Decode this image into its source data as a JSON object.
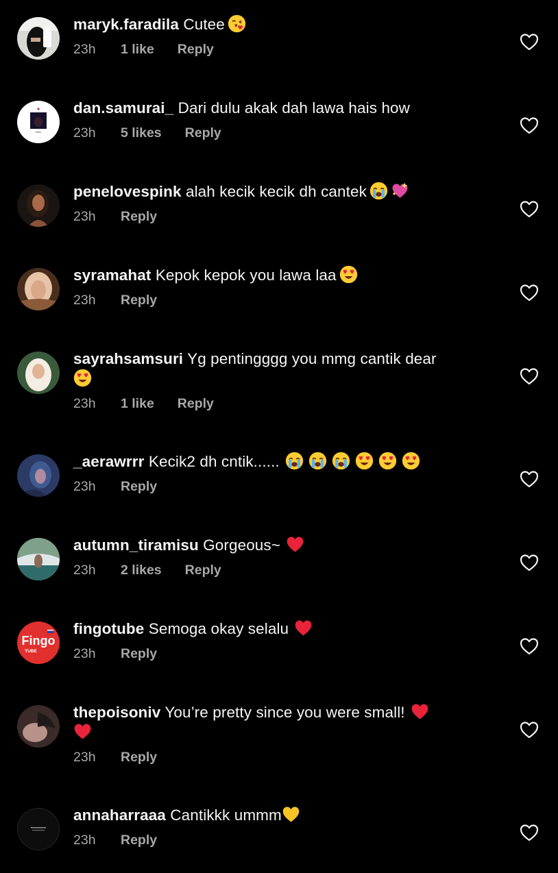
{
  "colors": {
    "background": "#000000",
    "text": "#f5f5f5",
    "meta": "#a8a8a8"
  },
  "comments": [
    {
      "username": "maryk.faradila",
      "message": "Cutee",
      "emojis": [
        "kissing-heart-emoji"
      ],
      "time": "23h",
      "likes": "1 like",
      "reply": "Reply"
    },
    {
      "username": "dan.samurai_",
      "message": "Dari dulu akak dah lawa hais how",
      "emojis": [],
      "time": "23h",
      "likes": "5 likes",
      "reply": "Reply"
    },
    {
      "username": "penelovespink",
      "message": "alah kecik kecik dh cantek",
      "emojis": [
        "loudly-crying-emoji",
        "sparkling-heart-emoji"
      ],
      "time": "23h",
      "likes": "",
      "reply": "Reply"
    },
    {
      "username": "syramahat",
      "message": "Kepok kepok you lawa laa",
      "emojis": [
        "heart-eyes-emoji"
      ],
      "time": "23h",
      "likes": "",
      "reply": "Reply"
    },
    {
      "username": "sayrahsamsuri",
      "message": "Yg pentingggg you mmg cantik dear",
      "emojis": [
        "heart-eyes-emoji"
      ],
      "time": "23h",
      "likes": "1 like",
      "reply": "Reply"
    },
    {
      "username": "_aerawrrr",
      "message": "Kecik2 dh cntik......",
      "emojis": [
        "loudly-crying-emoji",
        "loudly-crying-emoji",
        "loudly-crying-emoji",
        "heart-eyes-emoji",
        "heart-eyes-emoji",
        "heart-eyes-emoji"
      ],
      "time": "23h",
      "likes": "",
      "reply": "Reply"
    },
    {
      "username": "autumn_tiramisu",
      "message": "Gorgeous~",
      "emojis": [
        "red-heart-emoji"
      ],
      "time": "23h",
      "likes": "2 likes",
      "reply": "Reply"
    },
    {
      "username": "fingotube",
      "message": "Semoga okay selalu",
      "emojis": [
        "red-heart-emoji"
      ],
      "time": "23h",
      "likes": "",
      "reply": "Reply"
    },
    {
      "username": "thepoisoniv",
      "message": "You’re pretty since you were small!",
      "emojis": [
        "red-heart-emoji",
        "red-heart-emoji"
      ],
      "time": "23h",
      "likes": "",
      "reply": "Reply"
    },
    {
      "username": "annaharraaa",
      "message": "Cantikkk ummm",
      "emojis": [
        "yellow-heart-emoji"
      ],
      "time": "23h",
      "likes": "",
      "reply": "Reply"
    }
  ],
  "avatar_logo": {
    "fingotube_main": "Fingo",
    "fingotube_sub": "TUBE"
  }
}
